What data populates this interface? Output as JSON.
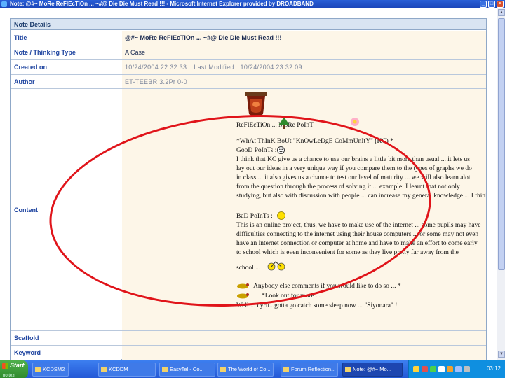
{
  "window": {
    "title": "Note: @#~ MoRe ReFlEcTiOn ... ~#@ Die Die Must Read !!! - Microsoft Internet Explorer provided by DROADBAND"
  },
  "panel": {
    "header": "Note Details",
    "rows": {
      "title_label": "Title",
      "title_value": "@#~ MoRe ReFlEcTiOn ... ~#@ Die Die Must Read !!!",
      "type_label": "Note / Thinking Type",
      "type_value": "A Case",
      "created_label": "Created on",
      "created_value": "10/24/2004 22:32:33",
      "modified_label": "Last Modified:",
      "modified_value": "10/24/2004 23:32:09",
      "author_label": "Author",
      "author_value": "ET-TEEBR 3.2Pr 0-0",
      "content_label": "Content",
      "scaffold_label": "Scaffold",
      "keyword_label": "Keyword"
    }
  },
  "content": {
    "lines": {
      "l1": "ReFlEcTiOn ... MoRe PoInT",
      "l2": "*WhAt ThInK BoUt \"KnOwLeDgE CoMmUnItY\" (KC) *",
      "l3": "GooD PoInTs :",
      "l4": "I think that KC give us a chance to use our brains a little bit more than usual ... it lets us",
      "l5": "lay out our ideas in a very unique way if you compare them to the types of graphs we do",
      "l6": "in class ... it also gives us a chance to test our level of maturity ... we will also learn alot",
      "l7": "from the question through the process of solving it ... example: I learnt that not only",
      "l8": "studying, but also with discussion with people ... can increase my general knowledge ... I think",
      "l9": "BaD PoInTs :",
      "l10": "This is an online project, thus, we have to make use of the internet ... some pupils may have",
      "l11": "difficulties connecting to the internet using their house computers ... or some may not even",
      "l12": "have an internet connection or computer at home and have to make an effort to come early",
      "l13": "to school which is even inconvenient for some as they live pretty far away from the",
      "l14": "school ...",
      "l15": "Anybody else comments if you would like to do so ... *",
      "l16": "*Look out for more ...",
      "l17": "Well ... cyrii...gotta go catch some sleep now ... \"Siyonara\" !"
    }
  },
  "taskbar": {
    "start_label": "Start",
    "start_sub": "no text",
    "tasks": {
      "t1": "KCDSM2",
      "t2": "KCDDM",
      "t3": "EasyTel - Co...",
      "t4": "The World of Co...",
      "t5": "Forum Reflection...",
      "t6": "Note: @#~ Mo..."
    },
    "clock": "03:12"
  },
  "colors": {
    "label_text": "#1f45a0",
    "value_background": "#fdf6e8",
    "annotation_circle": "#e0141a",
    "taskbar": "#2458d6"
  }
}
